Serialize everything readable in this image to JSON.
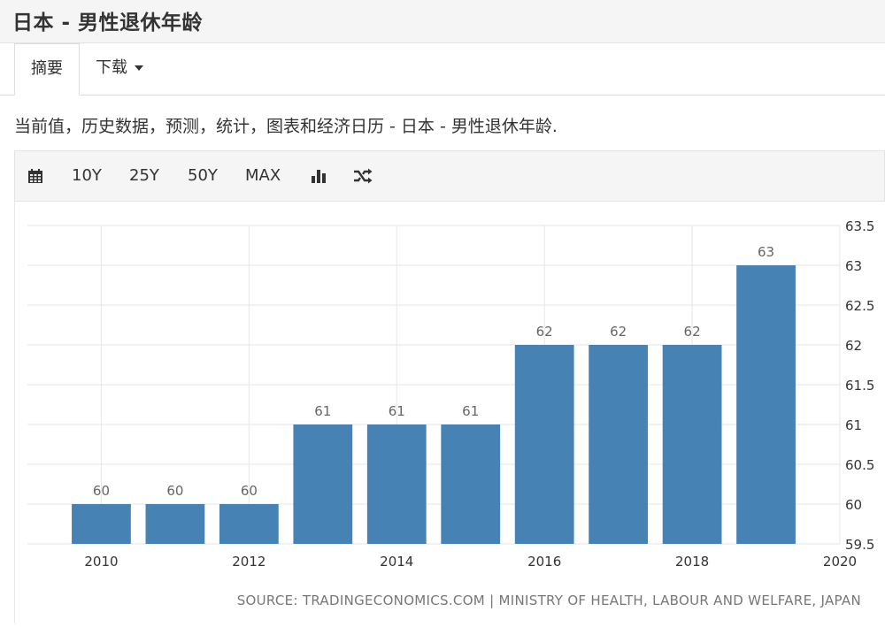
{
  "header": {
    "title": "日本 - 男性退休年龄"
  },
  "tabs": [
    {
      "label": "摘要"
    },
    {
      "label": "下载"
    }
  ],
  "description": "当前值，历史数据，预测，统计，图表和经济日历 - 日本 - 男性退休年龄.",
  "toolbar": {
    "calendar_icon": "calendar-icon",
    "ranges": [
      "10Y",
      "25Y",
      "50Y",
      "MAX"
    ],
    "chart_type_icon": "bar-chart-icon",
    "shuffle_icon": "shuffle-icon"
  },
  "source": "SOURCE: TRADINGECONOMICS.COM | MINISTRY OF HEALTH, LABOUR AND WELFARE, JAPAN",
  "colors": {
    "bar": "#4682b4",
    "grid": "#e6e6e6",
    "label": "#666666"
  },
  "chart_data": {
    "type": "bar",
    "title": "",
    "xlabel": "",
    "ylabel": "",
    "x": [
      2010,
      2011,
      2012,
      2013,
      2014,
      2015,
      2016,
      2017,
      2018,
      2019
    ],
    "values": [
      60,
      60,
      60,
      61,
      61,
      61,
      62,
      62,
      62,
      63
    ],
    "data_labels": [
      "60",
      "60",
      "60",
      "61",
      "61",
      "61",
      "62",
      "62",
      "62",
      "63"
    ],
    "xlim": [
      2009,
      2020
    ],
    "xticks": [
      "2010",
      "2012",
      "2014",
      "2016",
      "2018",
      "2020"
    ],
    "ylim": [
      59.5,
      63.5
    ],
    "yticks": [
      "59.5",
      "60",
      "60.5",
      "61",
      "61.5",
      "62",
      "62.5",
      "63",
      "63.5"
    ],
    "y_axis_side": "right",
    "grid": true
  }
}
